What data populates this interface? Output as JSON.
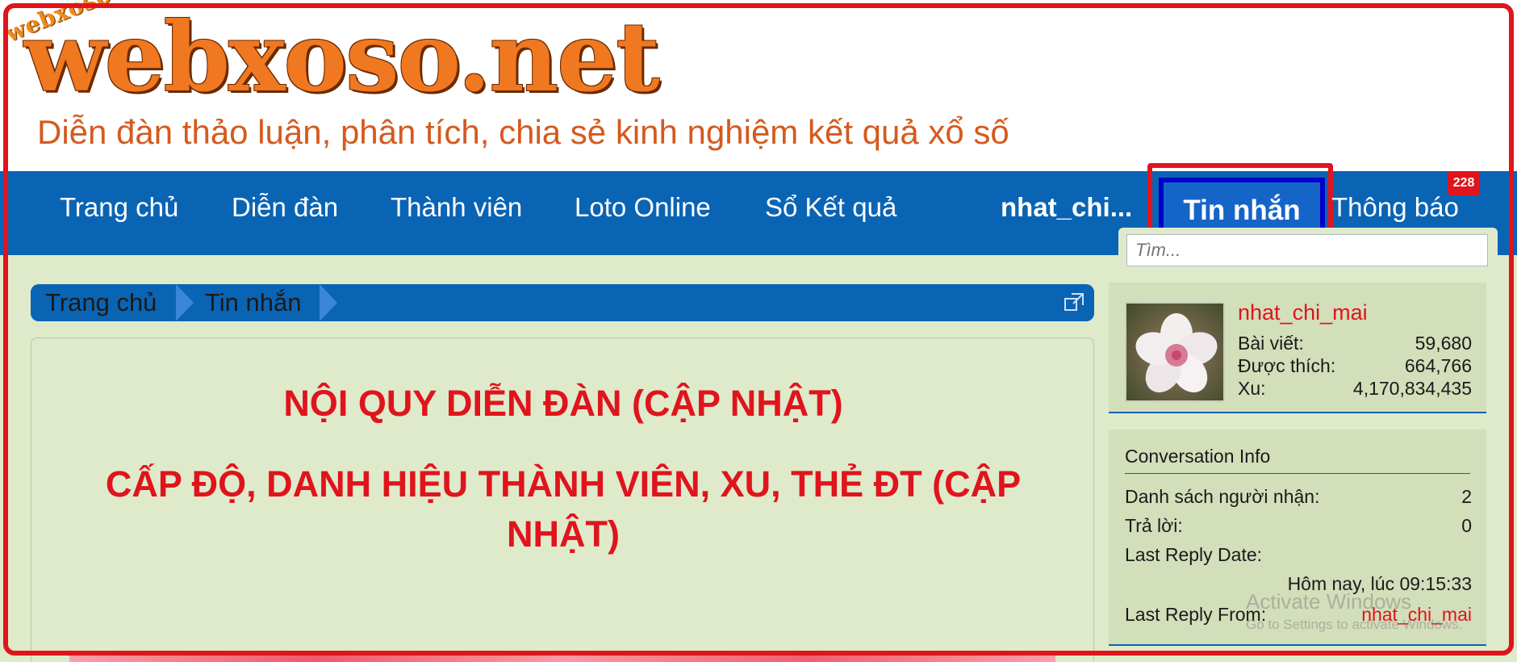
{
  "header": {
    "logo_tag": "webxoso.net",
    "logo_text": "webxoso.net",
    "tagline": "Diễn đàn thảo luận, phân tích, chia sẻ kinh nghiệm kết quả xổ số"
  },
  "nav": {
    "items": [
      "Trang chủ",
      "Diễn đàn",
      "Thành viên",
      "Loto Online",
      "Sổ Kết quả"
    ],
    "user": "nhat_chi...",
    "messages": "Tin nhắn",
    "notifications": "Thông báo",
    "notification_count": "228",
    "search_placeholder": "Tìm..."
  },
  "breadcrumb": [
    "Trang chủ",
    "Tin nhắn"
  ],
  "main": {
    "rule_1": "NỘI QUY DIỄN ĐÀN (CẬP NHẬT)",
    "rule_2_line1": "CẤP ĐỘ, DANH HIỆU THÀNH VIÊN, XU, THẺ ĐT (CẬP",
    "rule_2_line2": "NHẬT)"
  },
  "profile": {
    "username": "nhat_chi_mai",
    "stats": [
      {
        "label": "Bài viết:",
        "value": "59,680"
      },
      {
        "label": "Được thích:",
        "value": "664,766"
      },
      {
        "label": "Xu:",
        "value": "4,170,834,435"
      }
    ]
  },
  "conversation": {
    "title": "Conversation Info",
    "recipients_label": "Danh sách người nhận:",
    "recipients_value": "2",
    "replies_label": "Trả lời:",
    "replies_value": "0",
    "last_date_label": "Last Reply Date:",
    "last_date_value": "Hôm nay, lúc 09:15:33",
    "last_from_label": "Last Reply From:",
    "last_from_value": "nhat_chi_mai"
  },
  "watermark": {
    "line1": "Activate Windows",
    "line2": "Go to Settings to activate Windows."
  },
  "colors": {
    "nav_blue": "#0a64b4",
    "content_green": "#dfeacb",
    "highlight_red": "#e0141c",
    "logo_orange": "#f07820"
  }
}
